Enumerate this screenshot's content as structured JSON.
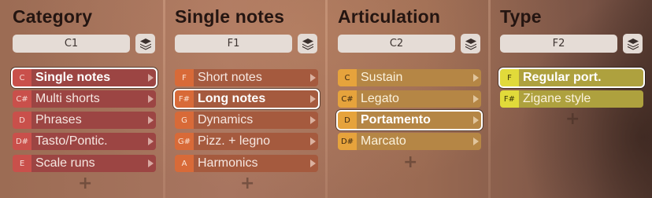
{
  "columns": [
    {
      "title": "Category",
      "key_value": "C1",
      "items": [
        {
          "key": "C",
          "label": "Single notes",
          "selected": true
        },
        {
          "key": "C#",
          "label": "Multi shorts"
        },
        {
          "key": "D",
          "label": "Phrases"
        },
        {
          "key": "D#",
          "label": "Tasto/Pontic."
        },
        {
          "key": "E",
          "label": "Scale runs"
        }
      ]
    },
    {
      "title": "Single notes",
      "key_value": "F1",
      "items": [
        {
          "key": "F",
          "label": "Short notes"
        },
        {
          "key": "F#",
          "label": "Long notes",
          "selected": true
        },
        {
          "key": "G",
          "label": "Dynamics"
        },
        {
          "key": "G#",
          "label": "Pizz. + legno"
        },
        {
          "key": "A",
          "label": "Harmonics"
        }
      ]
    },
    {
      "title": "Articulation",
      "key_value": "C2",
      "items": [
        {
          "key": "C",
          "label": "Sustain"
        },
        {
          "key": "C#",
          "label": "Legato"
        },
        {
          "key": "D",
          "label": "Portamento",
          "selected": true
        },
        {
          "key": "D#",
          "label": "Marcato"
        }
      ]
    },
    {
      "title": "Type",
      "key_value": "F2",
      "items": [
        {
          "key": "F",
          "label": "Regular port.",
          "selected": true
        },
        {
          "key": "F#",
          "label": "Zigane style"
        }
      ]
    }
  ],
  "icons": {
    "layers": "layers-icon",
    "arrow": "chevron-right-icon",
    "add": "plus-icon"
  },
  "add_symbol": "+"
}
